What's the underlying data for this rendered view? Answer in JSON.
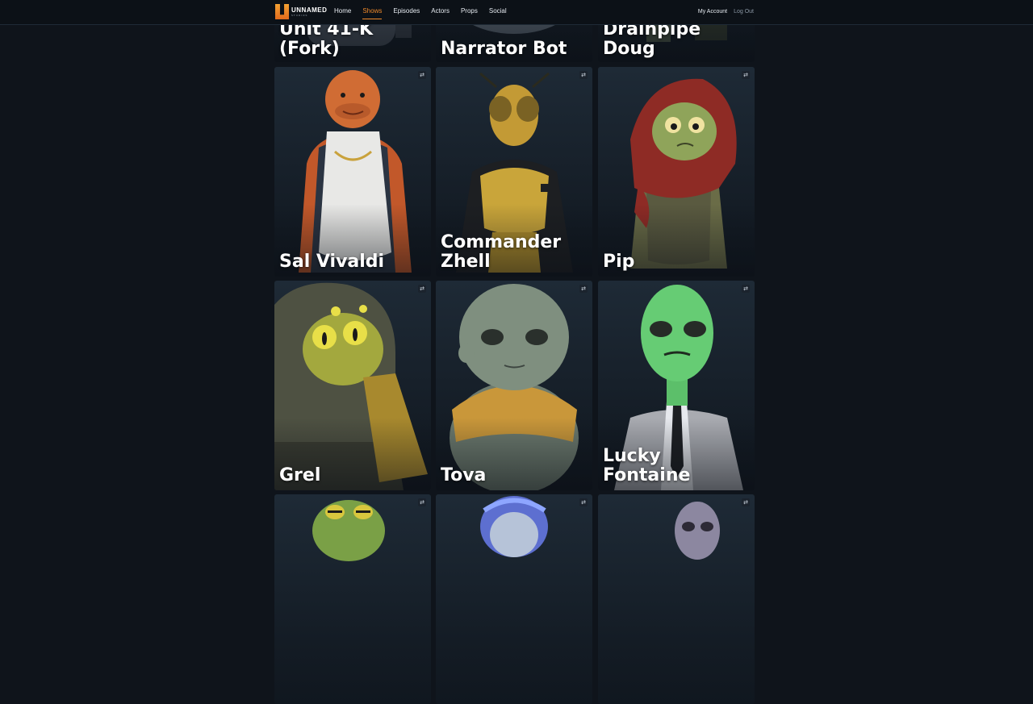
{
  "nav": {
    "logo_word": "UNNAMED",
    "logo_sub": "STUDIOS",
    "links": [
      {
        "label": "Home",
        "active": false
      },
      {
        "label": "Shows",
        "active": true
      },
      {
        "label": "Episodes",
        "active": false
      },
      {
        "label": "Actors",
        "active": false
      },
      {
        "label": "Props",
        "active": false
      },
      {
        "label": "Social",
        "active": false
      }
    ],
    "my_account": "My Account",
    "log_out": "Log Out"
  },
  "swap_icon_glyph": "⇄",
  "characters": {
    "row0": [
      "Unit 41-K (Fork)",
      "Narrator Bot",
      "Drainpipe Doug"
    ],
    "row1": [
      "Sal Vivaldi",
      "Commander Zhell",
      "Pip"
    ],
    "row2": [
      "Grel",
      "Tova",
      "Lucky Fontaine"
    ],
    "row3": [
      "",
      "",
      ""
    ]
  },
  "colors": {
    "accent": "#f08a2b",
    "background": "#0f141b"
  }
}
